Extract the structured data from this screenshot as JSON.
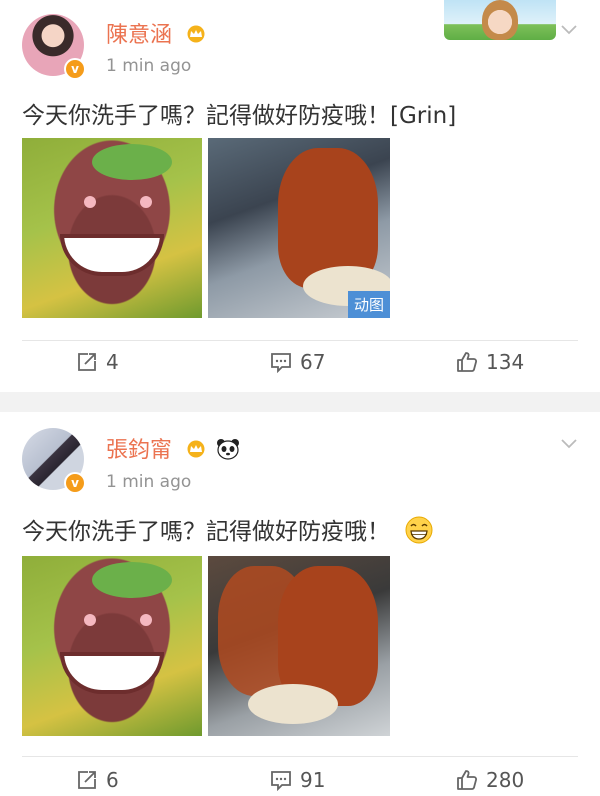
{
  "posts": [
    {
      "author": "陳意涵",
      "time": "1 min ago",
      "text": "今天你洗手了嗎？記得做好防疫哦！[Grin]",
      "gif_badge": "动图",
      "reposts": "4",
      "comments": "67",
      "likes": "134"
    },
    {
      "author": "張鈞甯",
      "time": "1 min ago",
      "text": "今天你洗手了嗎？記得做好防疫哦！",
      "reposts": "6",
      "comments": "91",
      "likes": "280"
    }
  ],
  "colors": {
    "name": "#eb7350",
    "badge": "#f59c1a",
    "gif_badge": "#4d8fd6",
    "time": "#939393"
  }
}
